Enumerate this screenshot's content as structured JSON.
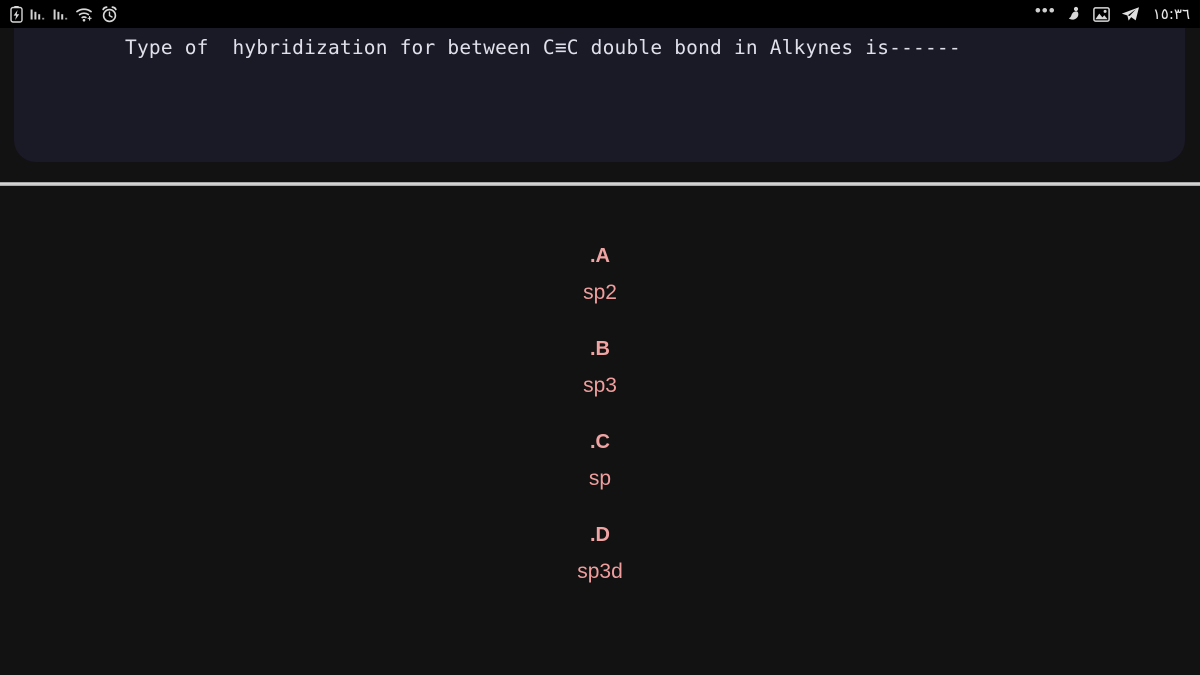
{
  "status_bar": {
    "left_icons": [
      {
        "name": "battery-charging-icon",
        "glyph": "battery"
      },
      {
        "name": "signal-bars-sim1-icon",
        "glyph": "bars"
      },
      {
        "name": "signal-bars-sim2-icon",
        "glyph": "bars"
      },
      {
        "name": "wifi-icon",
        "glyph": "wifi"
      },
      {
        "name": "alarm-clock-icon",
        "glyph": "alarm"
      }
    ],
    "overflow_dots": "•••",
    "right_icons": [
      {
        "name": "app-notification-icon",
        "glyph": "figure"
      },
      {
        "name": "screenshot-image-icon",
        "glyph": "image"
      },
      {
        "name": "telegram-icon",
        "glyph": "plane"
      }
    ],
    "time": "١٥:٣٦"
  },
  "question": {
    "text": "Type of  hybridization for between C≡C double bond in Alkynes is------"
  },
  "answers": [
    {
      "label": ".A",
      "value": "sp2"
    },
    {
      "label": ".B",
      "value": "sp3"
    },
    {
      "label": ".C",
      "value": "sp"
    },
    {
      "label": ".D",
      "value": "sp3d"
    }
  ],
  "colors": {
    "panel_background": "#1a1926",
    "page_background": "#121212",
    "status_background": "#000000",
    "question_text": "#dfe0ea",
    "answer_accent": "#ef9d9d",
    "divider": "#e4e4e4"
  }
}
